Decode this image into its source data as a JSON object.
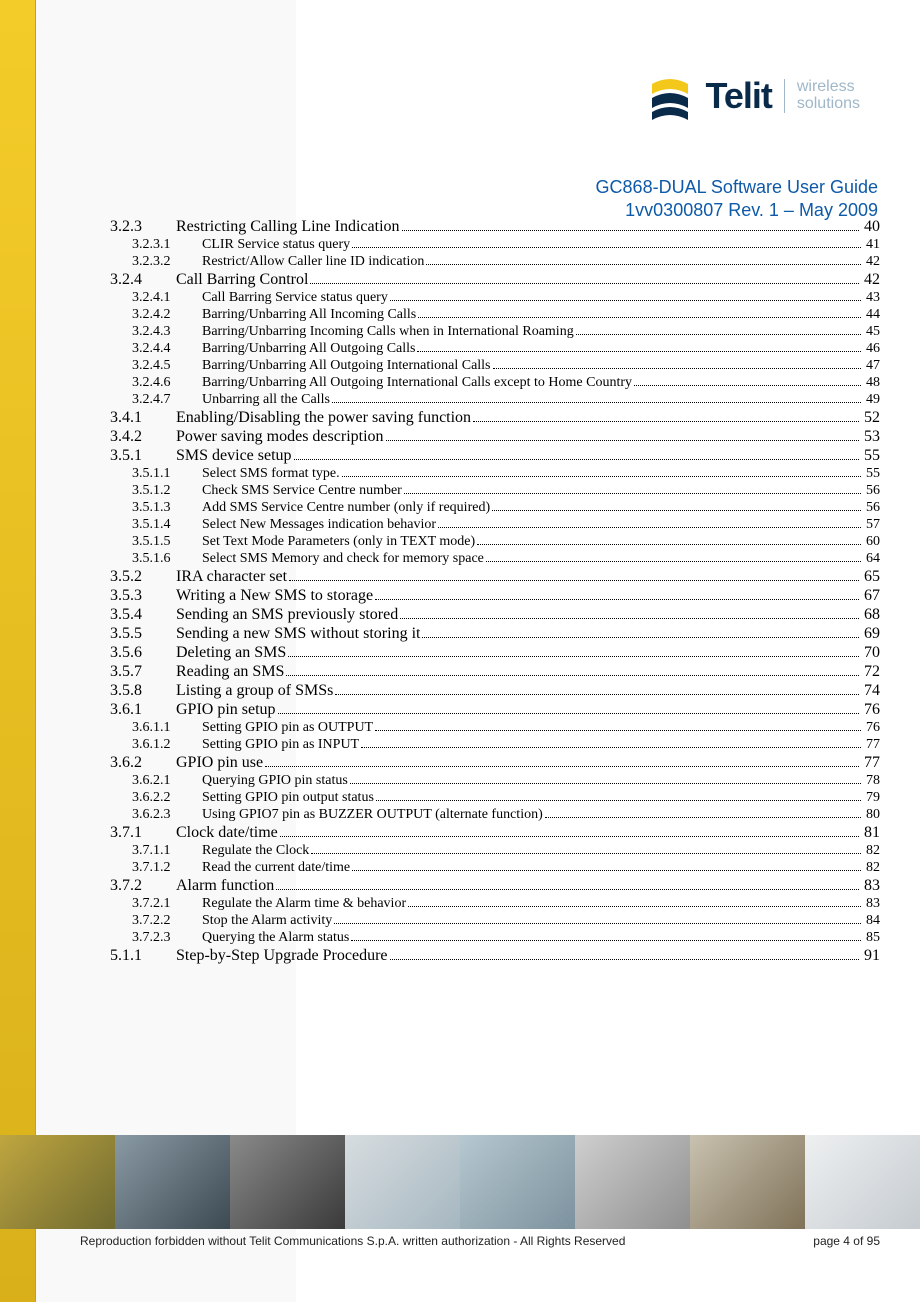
{
  "brand": {
    "name": "Telit",
    "tagline1": "wireless",
    "tagline2": "solutions"
  },
  "header": {
    "title": "GC868-DUAL Software User Guide",
    "rev": "1vv0300807  Rev. 1 – May 2009"
  },
  "toc": [
    {
      "level": 1,
      "num": "3.2.3",
      "title": "Restricting Calling Line Indication",
      "page": "40"
    },
    {
      "level": 2,
      "num": "3.2.3.1",
      "title": "CLIR Service status query",
      "page": "41"
    },
    {
      "level": 2,
      "num": "3.2.3.2",
      "title": "Restrict/Allow Caller line ID indication",
      "page": "42"
    },
    {
      "level": 1,
      "num": "3.2.4",
      "title": "Call Barring Control",
      "page": "42"
    },
    {
      "level": 2,
      "num": "3.2.4.1",
      "title": "Call Barring Service status query",
      "page": "43"
    },
    {
      "level": 2,
      "num": "3.2.4.2",
      "title": "Barring/Unbarring All Incoming Calls",
      "page": "44"
    },
    {
      "level": 2,
      "num": "3.2.4.3",
      "title": "Barring/Unbarring Incoming Calls when in International Roaming",
      "page": "45"
    },
    {
      "level": 2,
      "num": "3.2.4.4",
      "title": "Barring/Unbarring All Outgoing Calls",
      "page": "46"
    },
    {
      "level": 2,
      "num": "3.2.4.5",
      "title": "Barring/Unbarring All Outgoing International Calls",
      "page": "47"
    },
    {
      "level": 2,
      "num": "3.2.4.6",
      "title": "Barring/Unbarring All Outgoing International Calls except to Home Country",
      "page": "48"
    },
    {
      "level": 2,
      "num": "3.2.4.7",
      "title": "Unbarring all the Calls",
      "page": "49"
    },
    {
      "level": 1,
      "num": "3.4.1",
      "title": "Enabling/Disabling the power saving function",
      "page": "52"
    },
    {
      "level": 1,
      "num": "3.4.2",
      "title": "Power saving modes description",
      "page": "53"
    },
    {
      "level": 1,
      "num": "3.5.1",
      "title": "SMS device setup",
      "page": "55"
    },
    {
      "level": 2,
      "num": "3.5.1.1",
      "title": "Select SMS format type.",
      "page": "55"
    },
    {
      "level": 2,
      "num": "3.5.1.2",
      "title": "Check SMS Service Centre number",
      "page": "56"
    },
    {
      "level": 2,
      "num": "3.5.1.3",
      "title": "Add SMS Service Centre number (only if required)",
      "page": "56"
    },
    {
      "level": 2,
      "num": "3.5.1.4",
      "title": "Select New Messages indication behavior",
      "page": "57"
    },
    {
      "level": 2,
      "num": "3.5.1.5",
      "title": "Set Text Mode Parameters (only in TEXT mode)",
      "page": "60"
    },
    {
      "level": 2,
      "num": "3.5.1.6",
      "title": "Select SMS Memory and check for memory space",
      "page": "64"
    },
    {
      "level": 1,
      "num": "3.5.2",
      "title": "IRA character set",
      "page": "65"
    },
    {
      "level": 1,
      "num": "3.5.3",
      "title": "Writing a New SMS to storage",
      "page": "67"
    },
    {
      "level": 1,
      "num": "3.5.4",
      "title": "Sending an SMS previously stored",
      "page": "68"
    },
    {
      "level": 1,
      "num": "3.5.5",
      "title": "Sending a new SMS without storing it",
      "page": "69"
    },
    {
      "level": 1,
      "num": "3.5.6",
      "title": "Deleting an SMS",
      "page": "70"
    },
    {
      "level": 1,
      "num": "3.5.7",
      "title": "Reading an SMS",
      "page": "72"
    },
    {
      "level": 1,
      "num": "3.5.8",
      "title": "Listing a group of SMSs",
      "page": "74"
    },
    {
      "level": 1,
      "num": "3.6.1",
      "title": "GPIO pin setup",
      "page": "76"
    },
    {
      "level": 2,
      "num": "3.6.1.1",
      "title": "Setting GPIO pin as OUTPUT",
      "page": "76"
    },
    {
      "level": 2,
      "num": "3.6.1.2",
      "title": "Setting GPIO pin as INPUT",
      "page": "77"
    },
    {
      "level": 1,
      "num": "3.6.2",
      "title": "GPIO pin use",
      "page": "77"
    },
    {
      "level": 2,
      "num": "3.6.2.1",
      "title": "Querying GPIO pin status",
      "page": "78"
    },
    {
      "level": 2,
      "num": "3.6.2.2",
      "title": "Setting GPIO pin output status",
      "page": "79"
    },
    {
      "level": 2,
      "num": "3.6.2.3",
      "title": "Using GPIO7 pin as BUZZER OUTPUT (alternate function)",
      "page": "80"
    },
    {
      "level": 1,
      "num": "3.7.1",
      "title": "Clock date/time",
      "page": "81"
    },
    {
      "level": 2,
      "num": "3.7.1.1",
      "title": "Regulate the Clock",
      "page": "82"
    },
    {
      "level": 2,
      "num": "3.7.1.2",
      "title": "Read the current date/time",
      "page": "82"
    },
    {
      "level": 1,
      "num": "3.7.2",
      "title": "Alarm function",
      "page": "83"
    },
    {
      "level": 2,
      "num": "3.7.2.1",
      "title": "Regulate the Alarm time & behavior",
      "page": "83"
    },
    {
      "level": 2,
      "num": "3.7.2.2",
      "title": "Stop the Alarm activity",
      "page": "84"
    },
    {
      "level": 2,
      "num": "3.7.2.3",
      "title": "Querying the Alarm status",
      "page": "85"
    },
    {
      "level": 1,
      "num": "5.1.1",
      "title": "Step-by-Step Upgrade Procedure",
      "page": "91"
    }
  ],
  "footer": {
    "copyright": "Reproduction forbidden without Telit Communications S.p.A. written authorization - All Rights Reserved",
    "page": "page 4 of 95"
  }
}
